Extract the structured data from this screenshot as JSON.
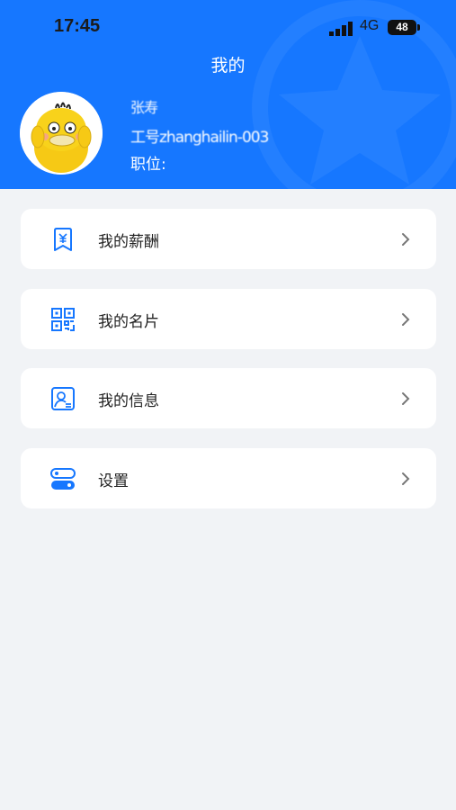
{
  "status_bar": {
    "time": "17:45",
    "network": "4G",
    "battery": "48"
  },
  "nav": {
    "title": "我的"
  },
  "user": {
    "name": "张寿",
    "id": "工号zhanghailin-003",
    "position_label": "职位:",
    "position_value": ""
  },
  "menu": [
    {
      "label": "我的薪酬",
      "icon": "salary-icon"
    },
    {
      "label": "我的名片",
      "icon": "qr-code-icon"
    },
    {
      "label": "我的信息",
      "icon": "profile-card-icon"
    },
    {
      "label": "设置",
      "icon": "settings-toggle-icon"
    }
  ],
  "colors": {
    "primary": "#1677ff",
    "background": "#f1f3f6",
    "card": "#ffffff",
    "text": "#222222"
  }
}
